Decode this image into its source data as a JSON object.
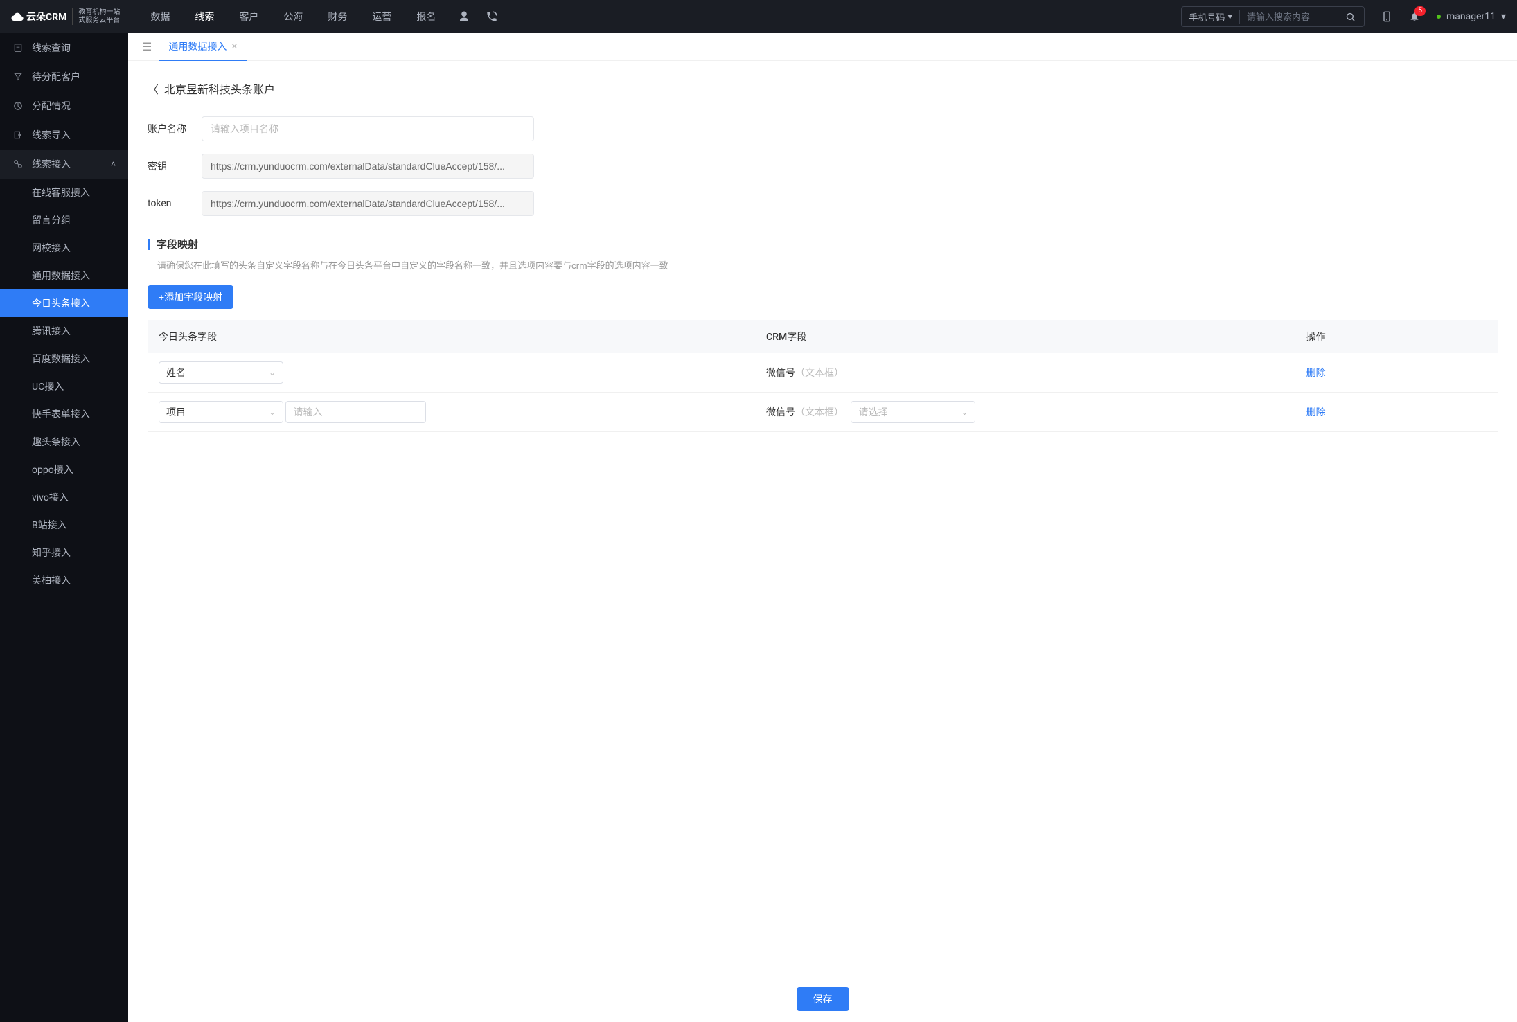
{
  "header": {
    "logo_brand": "云朵CRM",
    "logo_sub_line1": "教育机构一站",
    "logo_sub_line2": "式服务云平台",
    "nav": [
      "数据",
      "线索",
      "客户",
      "公海",
      "财务",
      "运营",
      "报名"
    ],
    "nav_active": "线索",
    "search_category": "手机号码",
    "search_placeholder": "请输入搜索内容",
    "notif_count": "5",
    "username": "manager11"
  },
  "sidebar": {
    "items": [
      {
        "label": "线索查询",
        "icon": "doc"
      },
      {
        "label": "待分配客户",
        "icon": "filter"
      },
      {
        "label": "分配情况",
        "icon": "chart"
      },
      {
        "label": "线索导入",
        "icon": "export"
      },
      {
        "label": "线索接入",
        "icon": "plug",
        "expanded": true
      }
    ],
    "sub_items": [
      "在线客服接入",
      "留言分组",
      "网校接入",
      "通用数据接入",
      "今日头条接入",
      "腾讯接入",
      "百度数据接入",
      "UC接入",
      "快手表单接入",
      "趣头条接入",
      "oppo接入",
      "vivo接入",
      "B站接入",
      "知乎接入",
      "美柚接入"
    ],
    "sub_active": "今日头条接入"
  },
  "tabs": {
    "items": [
      {
        "label": "通用数据接入",
        "active": true
      }
    ]
  },
  "page": {
    "title": "北京昱新科技头条账户",
    "form": {
      "name_label": "账户名称",
      "name_placeholder": "请输入项目名称",
      "secret_label": "密钥",
      "secret_value": "https://crm.yunduocrm.com/externalData/standardClueAccept/158/...",
      "token_label": "token",
      "token_value": "https://crm.yunduocrm.com/externalData/standardClueAccept/158/..."
    },
    "section": {
      "title": "字段映射",
      "desc": "请确保您在此填写的头条自定义字段名称与在今日头条平台中自定义的字段名称一致，并且选项内容要与crm字段的选项内容一致",
      "add_btn": "+添加字段映射"
    },
    "table": {
      "headers": [
        "今日头条字段",
        "CRM字段",
        "操作"
      ],
      "rows": [
        {
          "tt_select": "姓名",
          "tt_input": null,
          "crm_field": "微信号",
          "crm_hint": "（文本框）",
          "crm_select": null,
          "action": "删除"
        },
        {
          "tt_select": "项目",
          "tt_input": "",
          "tt_input_placeholder": "请输入",
          "crm_field": "微信号",
          "crm_hint": "（文本框）",
          "crm_select": "",
          "crm_select_placeholder": "请选择",
          "action": "删除"
        }
      ]
    },
    "save_btn": "保存"
  }
}
